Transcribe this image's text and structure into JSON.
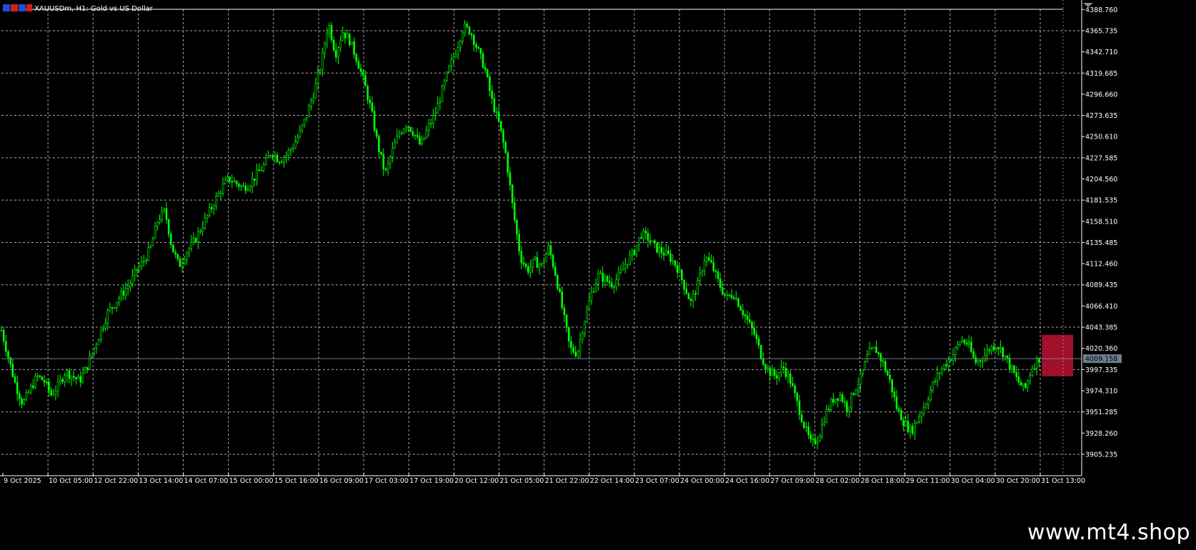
{
  "header": {
    "symbol_title": "XAUUSDm, H1:  Gold vs US Dollar"
  },
  "watermark": "www.mt4.shop",
  "colors": {
    "background": "#000000",
    "grid": "#c8c8c8",
    "frame": "#ffffff",
    "candle": "#00ff00",
    "bid_line": "#708090",
    "price_box": "#708090",
    "red_zone": "#a0102a",
    "axis_text": "#ffffff"
  },
  "chart_data": {
    "type": "candlestick",
    "title": "XAUUSDm, H1:  Gold vs US Dollar",
    "current_price": 4009.158,
    "current_price_label": "4009.158",
    "ylim": [
      3885.0,
      4389.0
    ],
    "y_ticks": [
      {
        "value": 4388.76,
        "label": "4388.760"
      },
      {
        "value": 4365.735,
        "label": "4365.735"
      },
      {
        "value": 4342.71,
        "label": "4342.710"
      },
      {
        "value": 4319.685,
        "label": "4319.685"
      },
      {
        "value": 4296.66,
        "label": "4296.660"
      },
      {
        "value": 4273.635,
        "label": "4273.635"
      },
      {
        "value": 4250.61,
        "label": "4250.610"
      },
      {
        "value": 4227.585,
        "label": "4227.585"
      },
      {
        "value": 4204.56,
        "label": "4204.560"
      },
      {
        "value": 4181.535,
        "label": "4181.535"
      },
      {
        "value": 4158.51,
        "label": "4158.510"
      },
      {
        "value": 4135.485,
        "label": "4135.485"
      },
      {
        "value": 4112.46,
        "label": "4112.460"
      },
      {
        "value": 4089.435,
        "label": "4089.435"
      },
      {
        "value": 4066.41,
        "label": "4066.410"
      },
      {
        "value": 4043.385,
        "label": "4043.385"
      },
      {
        "value": 4020.36,
        "label": "4020.360"
      },
      {
        "value": 3997.335,
        "label": "3997.335"
      },
      {
        "value": 3974.31,
        "label": "3974.310"
      },
      {
        "value": 3951.285,
        "label": "3951.285"
      },
      {
        "value": 3928.26,
        "label": "3928.260"
      },
      {
        "value": 3905.235,
        "label": "3905.235"
      }
    ],
    "x_ticks": [
      "9 Oct 2025",
      "10 Oct 05:00",
      "12 Oct 22:00",
      "13 Oct 14:00",
      "14 Oct 07:00",
      "15 Oct 00:00",
      "15 Oct 16:00",
      "16 Oct 09:00",
      "17 Oct 03:00",
      "17 Oct 19:00",
      "20 Oct 12:00",
      "21 Oct 05:00",
      "21 Oct 22:00",
      "22 Oct 14:00",
      "23 Oct 07:00",
      "24 Oct 00:00",
      "24 Oct 16:00",
      "27 Oct 09:00",
      "28 Oct 02:00",
      "28 Oct 18:00",
      "29 Oct 11:00",
      "30 Oct 04:00",
      "30 Oct 20:00",
      "31 Oct 13:00"
    ],
    "price_path": [
      [
        0,
        4040
      ],
      [
        2,
        4010
      ],
      [
        4,
        3980
      ],
      [
        6,
        3960
      ],
      [
        8,
        3975
      ],
      [
        10,
        3990
      ],
      [
        12,
        3985
      ],
      [
        14,
        3970
      ],
      [
        16,
        3980
      ],
      [
        18,
        3995
      ],
      [
        20,
        3990
      ],
      [
        22,
        3985
      ],
      [
        24,
        4000
      ],
      [
        26,
        4020
      ],
      [
        28,
        4040
      ],
      [
        30,
        4060
      ],
      [
        32,
        4070
      ],
      [
        34,
        4080
      ],
      [
        36,
        4090
      ],
      [
        38,
        4105
      ],
      [
        40,
        4115
      ],
      [
        42,
        4130
      ],
      [
        44,
        4160
      ],
      [
        46,
        4170
      ],
      [
        48,
        4130
      ],
      [
        50,
        4110
      ],
      [
        52,
        4125
      ],
      [
        54,
        4135
      ],
      [
        56,
        4150
      ],
      [
        58,
        4165
      ],
      [
        60,
        4180
      ],
      [
        62,
        4195
      ],
      [
        64,
        4205
      ],
      [
        66,
        4200
      ],
      [
        68,
        4195
      ],
      [
        70,
        4200
      ],
      [
        72,
        4210
      ],
      [
        74,
        4220
      ],
      [
        76,
        4235
      ],
      [
        78,
        4225
      ],
      [
        80,
        4230
      ],
      [
        82,
        4240
      ],
      [
        84,
        4255
      ],
      [
        86,
        4275
      ],
      [
        88,
        4300
      ],
      [
        90,
        4330
      ],
      [
        92,
        4375
      ],
      [
        94,
        4340
      ],
      [
        96,
        4365
      ],
      [
        98,
        4355
      ],
      [
        100,
        4335
      ],
      [
        102,
        4310
      ],
      [
        104,
        4280
      ],
      [
        106,
        4240
      ],
      [
        108,
        4210
      ],
      [
        110,
        4235
      ],
      [
        112,
        4255
      ],
      [
        114,
        4265
      ],
      [
        116,
        4255
      ],
      [
        118,
        4240
      ],
      [
        120,
        4260
      ],
      [
        122,
        4275
      ],
      [
        124,
        4300
      ],
      [
        126,
        4325
      ],
      [
        128,
        4345
      ],
      [
        130,
        4370
      ],
      [
        132,
        4365
      ],
      [
        134,
        4345
      ],
      [
        136,
        4325
      ],
      [
        138,
        4290
      ],
      [
        140,
        4265
      ],
      [
        142,
        4230
      ],
      [
        144,
        4170
      ],
      [
        146,
        4120
      ],
      [
        148,
        4105
      ],
      [
        150,
        4115
      ],
      [
        152,
        4110
      ],
      [
        154,
        4130
      ],
      [
        156,
        4100
      ],
      [
        158,
        4060
      ],
      [
        160,
        4020
      ],
      [
        162,
        4015
      ],
      [
        164,
        4050
      ],
      [
        166,
        4080
      ],
      [
        168,
        4100
      ],
      [
        170,
        4095
      ],
      [
        172,
        4090
      ],
      [
        174,
        4100
      ],
      [
        176,
        4115
      ],
      [
        178,
        4125
      ],
      [
        180,
        4145
      ],
      [
        182,
        4140
      ],
      [
        184,
        4130
      ],
      [
        186,
        4125
      ],
      [
        188,
        4120
      ],
      [
        190,
        4110
      ],
      [
        192,
        4090
      ],
      [
        194,
        4070
      ],
      [
        196,
        4090
      ],
      [
        198,
        4120
      ],
      [
        200,
        4110
      ],
      [
        202,
        4090
      ],
      [
        204,
        4075
      ],
      [
        206,
        4080
      ],
      [
        208,
        4065
      ],
      [
        210,
        4050
      ],
      [
        212,
        4035
      ],
      [
        214,
        4010
      ],
      [
        216,
        3995
      ],
      [
        218,
        3990
      ],
      [
        220,
        4000
      ],
      [
        222,
        3985
      ],
      [
        224,
        3960
      ],
      [
        226,
        3935
      ],
      [
        228,
        3915
      ],
      [
        230,
        3925
      ],
      [
        232,
        3950
      ],
      [
        234,
        3965
      ],
      [
        236,
        3970
      ],
      [
        238,
        3955
      ],
      [
        240,
        3975
      ],
      [
        242,
        3990
      ],
      [
        244,
        4015
      ],
      [
        246,
        4020
      ],
      [
        248,
        4005
      ],
      [
        250,
        3985
      ],
      [
        252,
        3955
      ],
      [
        254,
        3940
      ],
      [
        256,
        3930
      ],
      [
        258,
        3945
      ],
      [
        260,
        3960
      ],
      [
        262,
        3980
      ],
      [
        264,
        3995
      ],
      [
        266,
        4005
      ],
      [
        268,
        4015
      ],
      [
        270,
        4030
      ],
      [
        272,
        4025
      ],
      [
        274,
        4005
      ],
      [
        276,
        4010
      ],
      [
        278,
        4020
      ],
      [
        280,
        4025
      ],
      [
        282,
        4015
      ],
      [
        284,
        4000
      ],
      [
        286,
        3985
      ],
      [
        288,
        3975
      ],
      [
        290,
        4000
      ],
      [
        292,
        4010
      ]
    ],
    "red_zone": {
      "x_from": 292,
      "x_to": 304,
      "y_from": 3990,
      "y_to": 4035
    },
    "grid": true
  }
}
